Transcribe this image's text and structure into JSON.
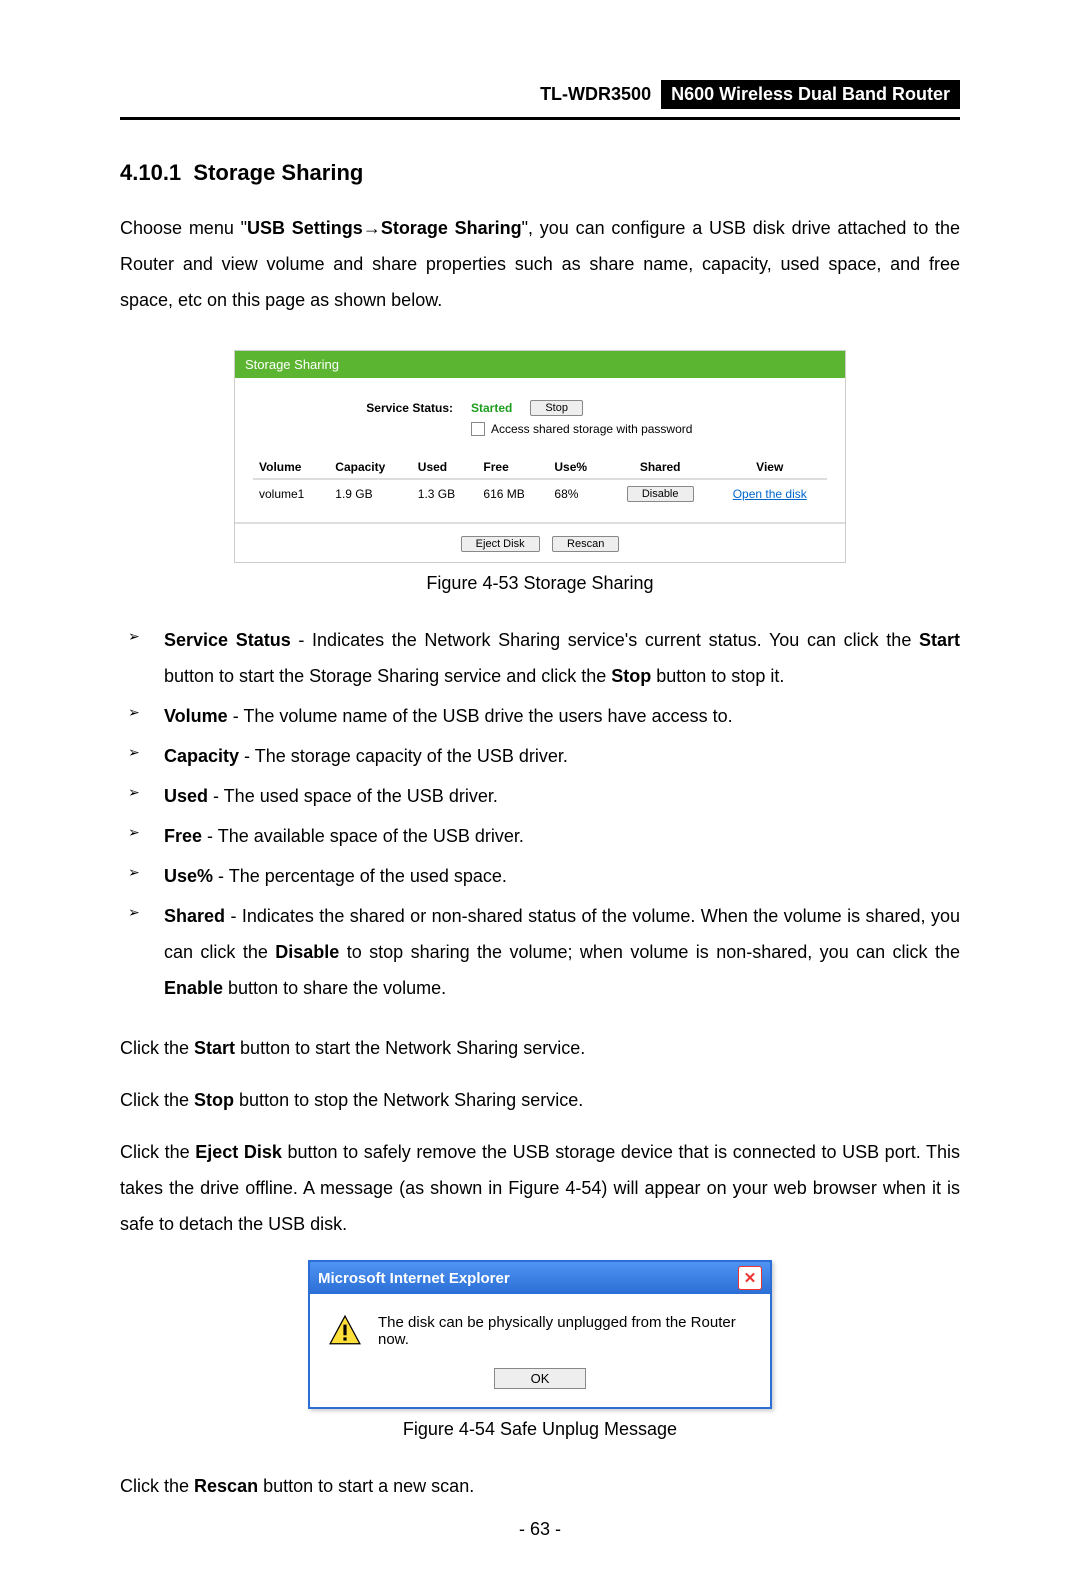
{
  "header": {
    "model": "TL-WDR3500",
    "product": "N600 Wireless Dual Band Router"
  },
  "section": {
    "number": "4.10.1",
    "title": "Storage Sharing"
  },
  "intro": {
    "pre": "Choose menu \"",
    "b1": "USB Settings",
    "arrow": "→",
    "b2": "Storage Sharing",
    "post": "\", you can configure a USB disk drive attached to the Router and view volume and share properties such as share name, capacity, used space, and free space, etc on this page as shown below."
  },
  "panel": {
    "title": "Storage Sharing",
    "service_label": "Service Status:",
    "service_value": "Started",
    "stop_btn": "Stop",
    "checkbox_label": "Access shared storage with password",
    "cols": [
      "Volume",
      "Capacity",
      "Used",
      "Free",
      "Use%",
      "Shared",
      "View"
    ],
    "row": {
      "volume": "volume1",
      "capacity": "1.9 GB",
      "used": "1.3 GB",
      "free": "616 MB",
      "usep": "68%",
      "shared_btn": "Disable",
      "view_link": "Open the disk"
    },
    "eject": "Eject Disk",
    "rescan": "Rescan"
  },
  "caption1": "Figure 4-53 Storage Sharing",
  "items": [
    {
      "b": "Service Status",
      "t": " - Indicates the Network Sharing service's current status. You can click the ",
      "b2": "Start",
      "t2": " button to start the Storage Sharing service and click the ",
      "b3": "Stop",
      "t3": " button to stop it."
    },
    {
      "b": "Volume",
      "t": " - The volume name of the USB drive the users have access to."
    },
    {
      "b": "Capacity",
      "t": " - The storage capacity of the USB driver."
    },
    {
      "b": "Used",
      "t": " - The used space of the USB driver."
    },
    {
      "b": "Free",
      "t": " - The available space of the USB driver."
    },
    {
      "b": "Use%",
      "t": " - The percentage of the used space."
    },
    {
      "b": "Shared",
      "t": " - Indicates the shared or non-shared status of the volume. When the volume is shared, you can click the ",
      "b2": "Disable",
      "t2": " to stop sharing the volume; when volume is non-shared, you can click the ",
      "b3": "Enable",
      "t3": " button to share the volume."
    }
  ],
  "p_start": {
    "pre": "Click the ",
    "b": "Start",
    "post": " button to start the Network Sharing service."
  },
  "p_stop": {
    "pre": "Click the ",
    "b": "Stop",
    "post": " button to stop the Network Sharing service."
  },
  "p_eject": {
    "pre": "Click the ",
    "b": "Eject Disk",
    "post": " button to safely remove the USB storage device that is connected to USB port. This takes the drive offline. A message (as shown in Figure 4-54) will appear on your web browser when it is safe to detach the USB disk."
  },
  "dialog": {
    "title": "Microsoft Internet Explorer",
    "msg": "The disk can be physically unplugged from the Router now.",
    "ok": "OK"
  },
  "caption2": "Figure 4-54 Safe Unplug Message",
  "p_rescan": {
    "pre": "Click the ",
    "b": "Rescan",
    "post": " button to start a new scan."
  },
  "pagenum": "- 63 -"
}
